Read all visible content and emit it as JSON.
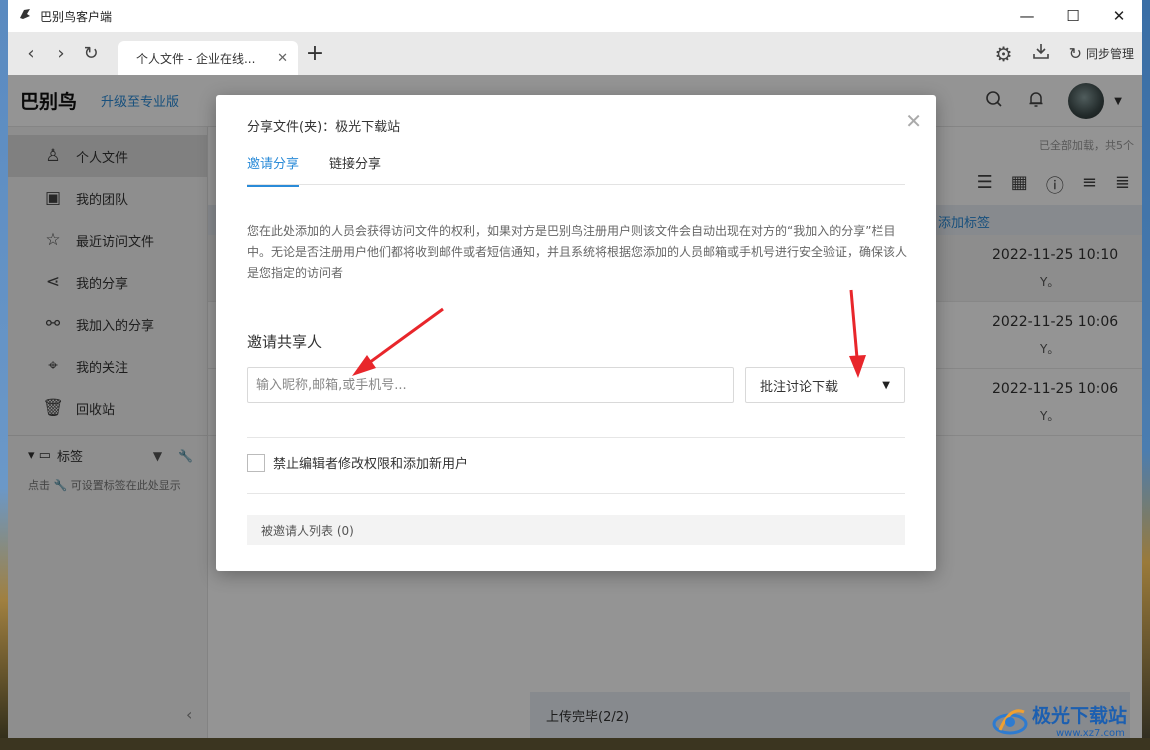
{
  "window": {
    "title": "巴别鸟客户端",
    "controls": {
      "minimize": "—",
      "maximize": "☐",
      "close": "✕"
    }
  },
  "tabbar": {
    "back": "‹",
    "forward": "›",
    "reload": "↻",
    "active_tab": "个人文件 - 企业在线...",
    "tab_close": "✕",
    "new_tab": "+",
    "sync_label": "同步管理"
  },
  "header": {
    "logo": "巴别鸟",
    "upgrade": "升级至专业版"
  },
  "sidebar": {
    "items": [
      {
        "icon": "user-icon",
        "glyph": "♙",
        "label": "个人文件"
      },
      {
        "icon": "team-icon",
        "glyph": "▣",
        "label": "我的团队"
      },
      {
        "icon": "star-icon",
        "glyph": "☆",
        "label": "最近访问文件"
      },
      {
        "icon": "share-icon",
        "glyph": "⋖",
        "label": "我的分享"
      },
      {
        "icon": "joined-share-icon",
        "glyph": "⚯",
        "label": "我加入的分享"
      },
      {
        "icon": "focus-icon",
        "glyph": "⌖",
        "label": "我的关注"
      },
      {
        "icon": "trash-icon",
        "glyph": "🗑",
        "label": "回收站"
      }
    ],
    "tags_title": "标签",
    "tags_hint": "点击 🔧 可设置标签在此处显示",
    "collapse": "‹"
  },
  "main": {
    "loaded_text": "已全部加载，共5个",
    "add_tag": "添加标签",
    "rows": [
      {
        "date": "2022-11-25 10:10",
        "owner": "Y。"
      },
      {
        "date": "2022-11-25 10:06",
        "owner": "Y。"
      },
      {
        "date": "2022-11-25 10:06",
        "owner": "Y。"
      }
    ],
    "upload_status": "上传完毕(2/2)"
  },
  "dialog": {
    "title": "分享文件(夹)：极光下载站",
    "close": "✕",
    "tabs": [
      "邀请分享",
      "链接分享"
    ],
    "description": "您在此处添加的人员会获得访问文件的权利，如果对方是巴别鸟注册用户则该文件会自动出现在对方的“我加入的分享”栏目中。无论是否注册用户他们都将收到邮件或者短信通知，并且系统将根据您添加的人员邮箱或手机号进行安全验证，确保该人是您指定的访问者",
    "invite_label": "邀请共享人",
    "invite_placeholder": "输入昵称,邮箱,或手机号...",
    "permission": "批注讨论下载",
    "checkbox_label": "禁止编辑者修改权限和添加新用户",
    "invitee_list": "被邀请人列表 (0)"
  },
  "colors": {
    "accent": "#2a8bd8",
    "arrow": "#e8262b",
    "watermark": "#1c5fb0"
  },
  "watermark": {
    "main": "极光下载站",
    "sub": "www.xz7.com"
  }
}
